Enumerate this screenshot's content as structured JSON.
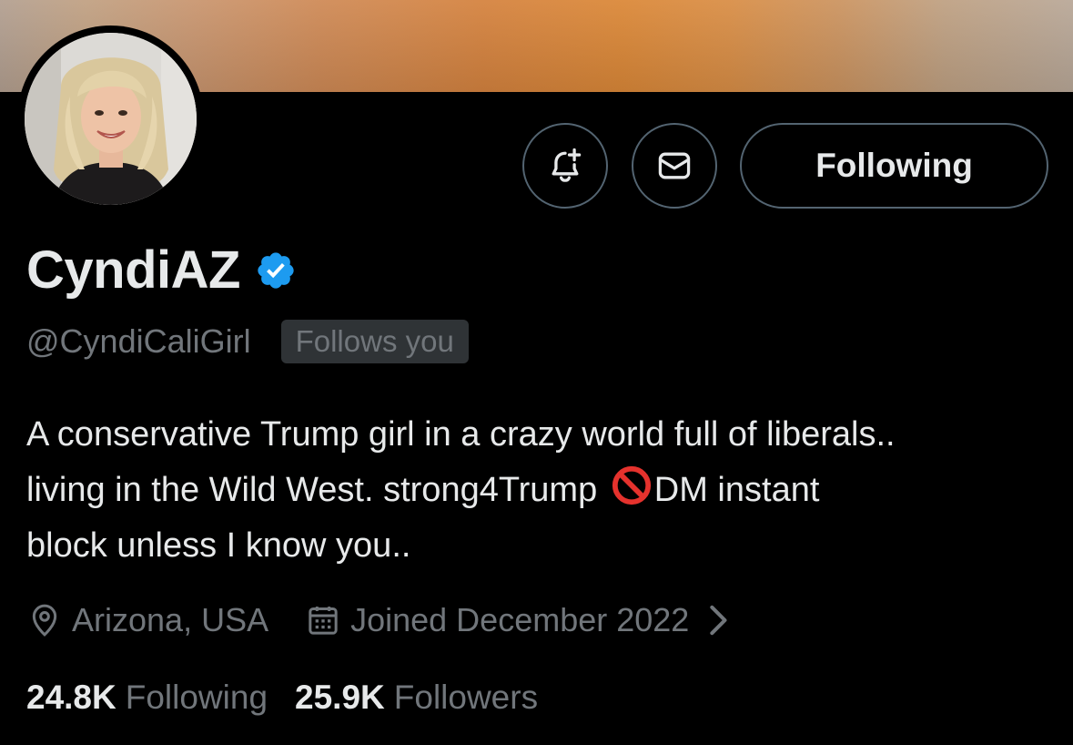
{
  "profile": {
    "display_name": "CyndiAZ",
    "handle": "@CyndiCaliGirl",
    "follows_you_badge": "Follows you",
    "verified": true,
    "bio": {
      "line1": "A conservative Trump girl in a crazy world full of liberals..",
      "line2_a": "living in the Wild West. strong4Trump ",
      "line2_b": "DM instant",
      "line3": "block unless I know you.."
    },
    "location": "Arizona, USA",
    "joined": "Joined December 2022",
    "following_count": "24.8K",
    "following_label": "Following",
    "followers_count": "25.9K",
    "followers_label": "Followers"
  },
  "actions": {
    "following_button_label": "Following",
    "notify_icon": "bell-plus-icon",
    "message_icon": "envelope-icon"
  },
  "colors": {
    "background": "#000000",
    "text_primary": "#e7e9ea",
    "text_secondary": "#71767b",
    "border": "#536471",
    "verified_blue": "#1d9bf0",
    "badge_bg": "#2f3336"
  }
}
